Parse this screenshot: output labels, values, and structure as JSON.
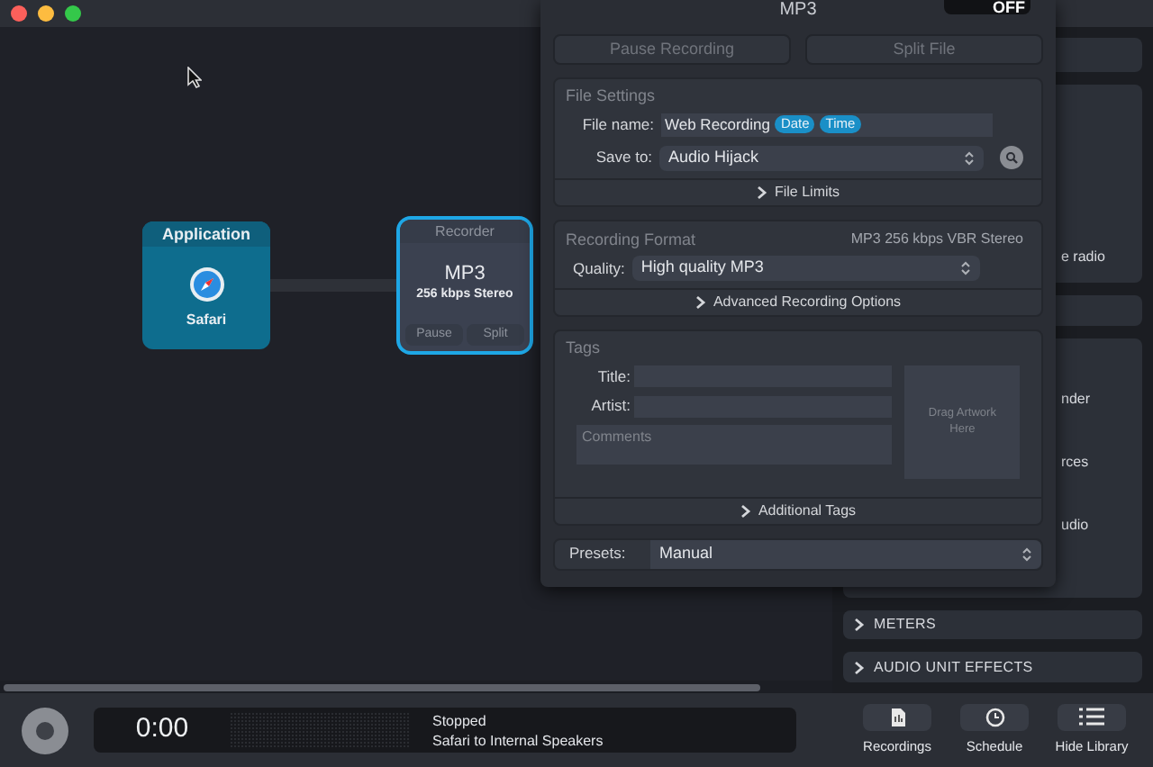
{
  "canvas": {
    "nodes": [
      {
        "kind": "application",
        "header": "Application",
        "label": "Safari",
        "selected": false
      },
      {
        "kind": "recorder",
        "header": "Recorder",
        "format": "MP3",
        "detail": "256 kbps Stereo",
        "buttons": [
          "Pause",
          "Split"
        ],
        "selected": true
      }
    ]
  },
  "popover": {
    "title": "MP3",
    "toggle": {
      "label": "OFF",
      "on": false
    },
    "actions": [
      {
        "label": "Pause Recording",
        "disabled": true
      },
      {
        "label": "Split File",
        "disabled": true
      }
    ],
    "file_settings": {
      "heading": "File Settings",
      "file_name": {
        "label": "File name:",
        "value": "Web Recording",
        "tokens": [
          "Date",
          "Time"
        ]
      },
      "save_to": {
        "label": "Save to:",
        "value": "Audio Hijack"
      },
      "disclosure": "File Limits"
    },
    "recording_format": {
      "heading": "Recording Format",
      "summary": "MP3 256 kbps VBR Stereo",
      "quality": {
        "label": "Quality:",
        "value": "High quality MP3"
      },
      "disclosure": "Advanced Recording Options"
    },
    "tags": {
      "heading": "Tags",
      "fields": [
        {
          "label": "Title:"
        },
        {
          "label": "Artist:"
        }
      ],
      "comments": {
        "placeholder": "Comments"
      },
      "artwork": "Drag Artwork Here",
      "disclosure": "Additional Tags"
    },
    "presets": {
      "label": "Presets:",
      "value": "Manual"
    }
  },
  "library": {
    "cards": [
      {
        "lines": [
          "e radio"
        ]
      },
      {
        "lines": [
          "nder",
          "rces",
          "udio"
        ]
      }
    ],
    "sections": [
      {
        "label": "METERS",
        "expanded": false
      },
      {
        "label": "AUDIO UNIT EFFECTS",
        "expanded": false
      }
    ]
  },
  "transport": {
    "time": "0:00",
    "status": "Stopped",
    "route": "Safari to Internal Speakers"
  },
  "toolbar": [
    {
      "kind": "recordings",
      "label": "Recordings"
    },
    {
      "kind": "schedule",
      "label": "Schedule"
    },
    {
      "kind": "library",
      "label": "Hide Library"
    }
  ]
}
